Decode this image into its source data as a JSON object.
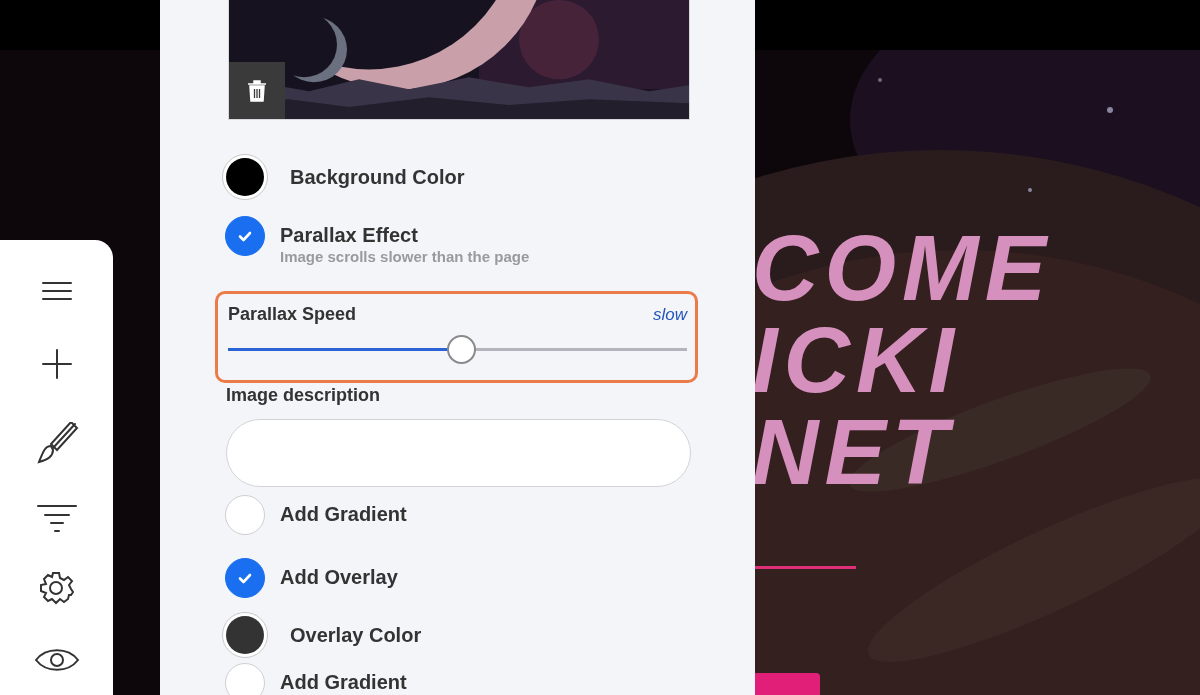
{
  "settings": [
    {
      "kind": "color",
      "label": "Background Color",
      "color": "#000000"
    },
    {
      "kind": "toggle",
      "label": "Parallax Effect",
      "description": "Image scrolls slower than the page",
      "checked": true
    },
    {
      "kind": "slider",
      "label": "Parallax Speed",
      "reading": "slow",
      "level": 0.51,
      "highlighted": true
    },
    {
      "kind": "text",
      "label": "Image description"
    },
    {
      "kind": "toggle",
      "label": "Add Gradient",
      "checked": false
    },
    {
      "kind": "toggle",
      "label": "Add Overlay",
      "checked": true
    },
    {
      "kind": "color",
      "label": "Overlay Color",
      "color": "#333333"
    },
    {
      "kind": "toggle",
      "label": "Add Gradient",
      "checked": false
    }
  ],
  "hero": {
    "headline_lines": [
      "COME",
      "ICKI",
      "NET"
    ]
  }
}
